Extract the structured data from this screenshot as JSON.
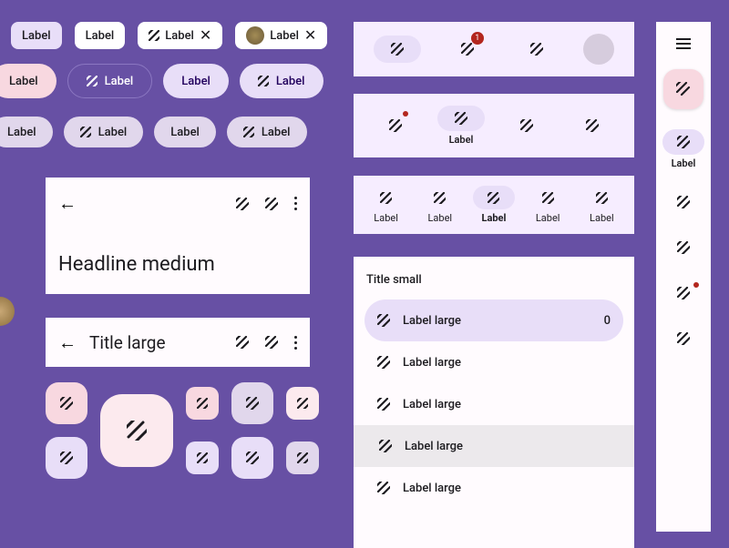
{
  "chips": {
    "c1": "Label",
    "c2": "Label",
    "c3": "Label",
    "c4": "Label"
  },
  "btns2": {
    "b1": "Label",
    "b2": "Label",
    "b3": "Label",
    "b4": "Label"
  },
  "btns3": {
    "b1": "Label",
    "b2": "Label",
    "b3": "Label",
    "b4": "Label"
  },
  "appbar1": {
    "headline": "Headline medium"
  },
  "appbar2": {
    "title": "Title large"
  },
  "nav1": {
    "badge": "1"
  },
  "nav2": {
    "label": "Label"
  },
  "nav3": {
    "l1": "Label",
    "l2": "Label",
    "l3": "Label",
    "l4": "Label",
    "l5": "Label"
  },
  "list": {
    "title": "Title small",
    "rows": {
      "r1": "Label large",
      "r1_count": "0",
      "r2": "Label large",
      "r3": "Label large",
      "r4": "Label large",
      "r5": "Label large"
    }
  },
  "rail": {
    "label": "Label"
  }
}
